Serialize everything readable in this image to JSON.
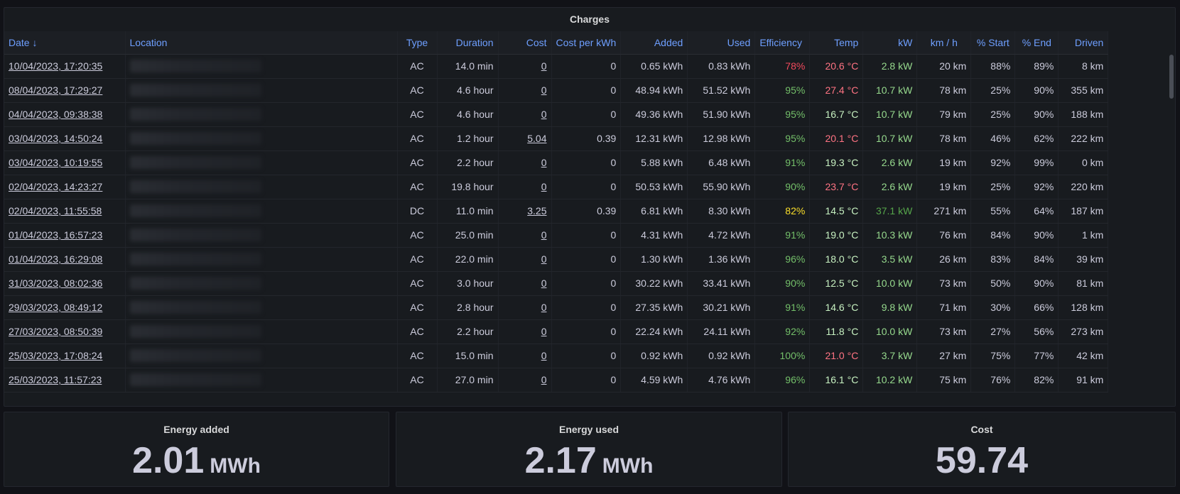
{
  "charges_panel": {
    "title": "Charges",
    "columns": [
      "Date",
      "Location",
      "Type",
      "Duration",
      "Cost",
      "Cost per kWh",
      "Added",
      "Used",
      "Efficiency",
      "Temp",
      "kW",
      "km / h",
      "% Start",
      "% End",
      "Driven"
    ],
    "sort_indicator": "↓",
    "rows": [
      {
        "date": "10/04/2023, 17:20:35",
        "type": "AC",
        "duration": "14.0 min",
        "cost": "0",
        "cost_per_kwh": "0",
        "added": "0.65 kWh",
        "used": "0.83 kWh",
        "efficiency": "78%",
        "temp": "20.6 °C",
        "kw": "2.8 kW",
        "kmh": "20 km",
        "start": "88%",
        "end": "89%",
        "driven": "8 km"
      },
      {
        "date": "08/04/2023, 17:29:27",
        "type": "AC",
        "duration": "4.6 hour",
        "cost": "0",
        "cost_per_kwh": "0",
        "added": "48.94 kWh",
        "used": "51.52 kWh",
        "efficiency": "95%",
        "temp": "27.4 °C",
        "kw": "10.7 kW",
        "kmh": "78 km",
        "start": "25%",
        "end": "90%",
        "driven": "355 km"
      },
      {
        "date": "04/04/2023, 09:38:38",
        "type": "AC",
        "duration": "4.6 hour",
        "cost": "0",
        "cost_per_kwh": "0",
        "added": "49.36 kWh",
        "used": "51.90 kWh",
        "efficiency": "95%",
        "temp": "16.7 °C",
        "kw": "10.7 kW",
        "kmh": "79 km",
        "start": "25%",
        "end": "90%",
        "driven": "188 km"
      },
      {
        "date": "03/04/2023, 14:50:24",
        "type": "AC",
        "duration": "1.2 hour",
        "cost": "5.04",
        "cost_per_kwh": "0.39",
        "added": "12.31 kWh",
        "used": "12.98 kWh",
        "efficiency": "95%",
        "temp": "20.1 °C",
        "kw": "10.7 kW",
        "kmh": "78 km",
        "start": "46%",
        "end": "62%",
        "driven": "222 km"
      },
      {
        "date": "03/04/2023, 10:19:55",
        "type": "AC",
        "duration": "2.2 hour",
        "cost": "0",
        "cost_per_kwh": "0",
        "added": "5.88 kWh",
        "used": "6.48 kWh",
        "efficiency": "91%",
        "temp": "19.3 °C",
        "kw": "2.6 kW",
        "kmh": "19 km",
        "start": "92%",
        "end": "99%",
        "driven": "0 km"
      },
      {
        "date": "02/04/2023, 14:23:27",
        "type": "AC",
        "duration": "19.8 hour",
        "cost": "0",
        "cost_per_kwh": "0",
        "added": "50.53 kWh",
        "used": "55.90 kWh",
        "efficiency": "90%",
        "temp": "23.7 °C",
        "kw": "2.6 kW",
        "kmh": "19 km",
        "start": "25%",
        "end": "92%",
        "driven": "220 km"
      },
      {
        "date": "02/04/2023, 11:55:58",
        "type": "DC",
        "duration": "11.0 min",
        "cost": "3.25",
        "cost_per_kwh": "0.39",
        "added": "6.81 kWh",
        "used": "8.30 kWh",
        "efficiency": "82%",
        "temp": "14.5 °C",
        "kw": "37.1 kW",
        "kmh": "271 km",
        "start": "55%",
        "end": "64%",
        "driven": "187 km"
      },
      {
        "date": "01/04/2023, 16:57:23",
        "type": "AC",
        "duration": "25.0 min",
        "cost": "0",
        "cost_per_kwh": "0",
        "added": "4.31 kWh",
        "used": "4.72 kWh",
        "efficiency": "91%",
        "temp": "19.0 °C",
        "kw": "10.3 kW",
        "kmh": "76 km",
        "start": "84%",
        "end": "90%",
        "driven": "1 km"
      },
      {
        "date": "01/04/2023, 16:29:08",
        "type": "AC",
        "duration": "22.0 min",
        "cost": "0",
        "cost_per_kwh": "0",
        "added": "1.30 kWh",
        "used": "1.36 kWh",
        "efficiency": "96%",
        "temp": "18.0 °C",
        "kw": "3.5 kW",
        "kmh": "26 km",
        "start": "83%",
        "end": "84%",
        "driven": "39 km"
      },
      {
        "date": "31/03/2023, 08:02:36",
        "type": "AC",
        "duration": "3.0 hour",
        "cost": "0",
        "cost_per_kwh": "0",
        "added": "30.22 kWh",
        "used": "33.41 kWh",
        "efficiency": "90%",
        "temp": "12.5 °C",
        "kw": "10.0 kW",
        "kmh": "73 km",
        "start": "50%",
        "end": "90%",
        "driven": "81 km"
      },
      {
        "date": "29/03/2023, 08:49:12",
        "type": "AC",
        "duration": "2.8 hour",
        "cost": "0",
        "cost_per_kwh": "0",
        "added": "27.35 kWh",
        "used": "30.21 kWh",
        "efficiency": "91%",
        "temp": "14.6 °C",
        "kw": "9.8 kW",
        "kmh": "71 km",
        "start": "30%",
        "end": "66%",
        "driven": "128 km"
      },
      {
        "date": "27/03/2023, 08:50:39",
        "type": "AC",
        "duration": "2.2 hour",
        "cost": "0",
        "cost_per_kwh": "0",
        "added": "22.24 kWh",
        "used": "24.11 kWh",
        "efficiency": "92%",
        "temp": "11.8 °C",
        "kw": "10.0 kW",
        "kmh": "73 km",
        "start": "27%",
        "end": "56%",
        "driven": "273 km"
      },
      {
        "date": "25/03/2023, 17:08:24",
        "type": "AC",
        "duration": "15.0 min",
        "cost": "0",
        "cost_per_kwh": "0",
        "added": "0.92 kWh",
        "used": "0.92 kWh",
        "efficiency": "100%",
        "temp": "21.0 °C",
        "kw": "3.7 kW",
        "kmh": "27 km",
        "start": "75%",
        "end": "77%",
        "driven": "42 km"
      },
      {
        "date": "25/03/2023, 11:57:23",
        "type": "AC",
        "duration": "27.0 min",
        "cost": "0",
        "cost_per_kwh": "0",
        "added": "4.59 kWh",
        "used": "4.76 kWh",
        "efficiency": "96%",
        "temp": "16.1 °C",
        "kw": "10.2 kW",
        "kmh": "75 km",
        "start": "76%",
        "end": "82%",
        "driven": "91 km"
      }
    ]
  },
  "stats": {
    "energy_added": {
      "title": "Energy added",
      "value": "2.01",
      "unit": "MWh"
    },
    "energy_used": {
      "title": "Energy used",
      "value": "2.17",
      "unit": "MWh"
    },
    "cost": {
      "title": "Cost",
      "value": "59.74",
      "unit": ""
    }
  },
  "colors": {
    "background": "#111217",
    "panel": "#181b1f",
    "header_text": "#6e9fff",
    "efficiency_red": "#f2495c",
    "efficiency_green": "#73bf69",
    "efficiency_yellow": "#fade2a",
    "temp_warm": "#ff7383",
    "temp_cool": "#c8f2c2",
    "kw_green": "#96d98d"
  }
}
